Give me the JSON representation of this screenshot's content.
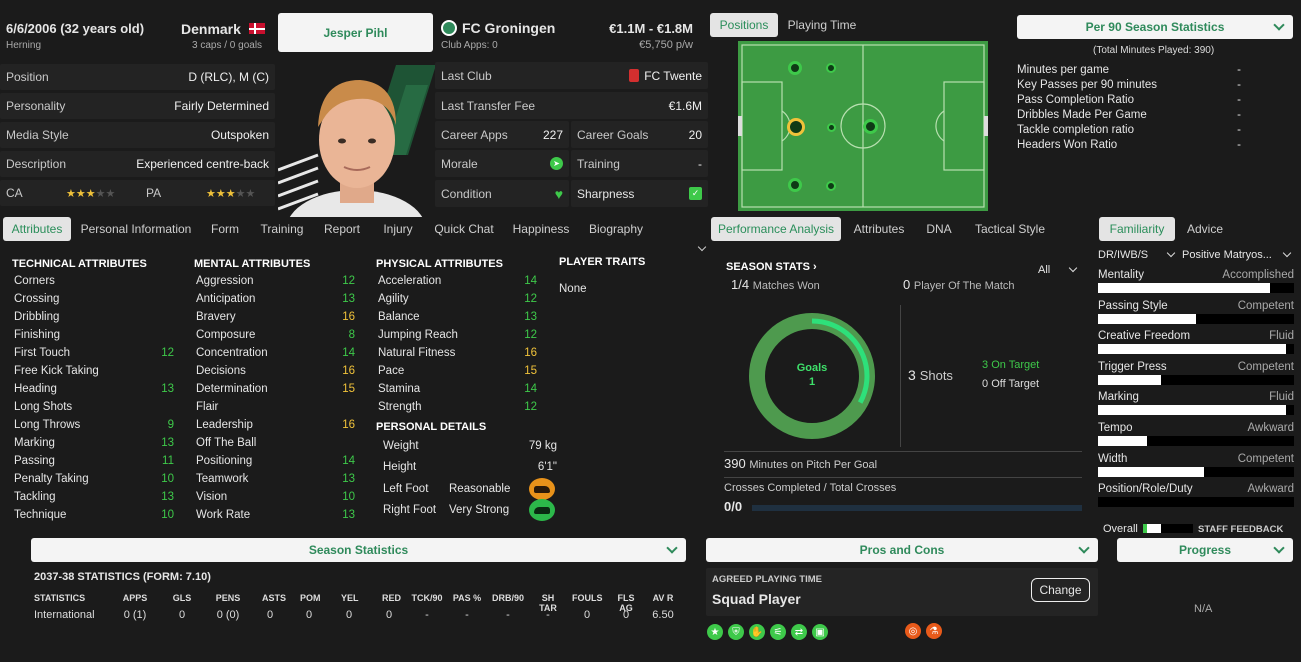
{
  "header": {
    "dob": "6/6/2006 (32 years old)",
    "birthplace": "Herning",
    "nation": "Denmark",
    "caps": "3 caps / 0 goals",
    "name": "Jesper Pihl",
    "club": "FC Groningen",
    "club_apps": "Club Apps: 0",
    "value": "€1.1M - €1.8M",
    "wage": "€5,750 p/w"
  },
  "profile": [
    {
      "label": "Position",
      "value": "D (RLC), M (C)"
    },
    {
      "label": "Personality",
      "value": "Fairly Determined"
    },
    {
      "label": "Media Style",
      "value": "Outspoken"
    },
    {
      "label": "Description",
      "value": "Experienced centre-back"
    }
  ],
  "ability": {
    "ca_label": "CA",
    "pa_label": "PA",
    "ca_stars": 2.5,
    "pa_stars": 2.5
  },
  "career": {
    "last_club_label": "Last Club",
    "last_club": "FC Twente",
    "fee_label": "Last Transfer Fee",
    "fee": "€1.6M",
    "apps_label": "Career Apps",
    "apps": "227",
    "goals_label": "Career Goals",
    "goals": "20",
    "morale_label": "Morale",
    "training_label": "Training",
    "training": "-",
    "condition_label": "Condition",
    "sharpness_label": "Sharpness"
  },
  "main_tabs": [
    "Attributes",
    "Personal Information",
    "Form",
    "Training",
    "Report",
    "Injury",
    "Quick Chat",
    "Happiness",
    "Biography"
  ],
  "technical": {
    "title": "TECHNICAL ATTRIBUTES",
    "items": [
      {
        "n": "Corners",
        "v": ""
      },
      {
        "n": "Crossing",
        "v": ""
      },
      {
        "n": "Dribbling",
        "v": ""
      },
      {
        "n": "Finishing",
        "v": ""
      },
      {
        "n": "First Touch",
        "v": "12"
      },
      {
        "n": "Free Kick Taking",
        "v": ""
      },
      {
        "n": "Heading",
        "v": "13"
      },
      {
        "n": "Long Shots",
        "v": ""
      },
      {
        "n": "Long Throws",
        "v": "9"
      },
      {
        "n": "Marking",
        "v": "13"
      },
      {
        "n": "Passing",
        "v": "11"
      },
      {
        "n": "Penalty Taking",
        "v": "10"
      },
      {
        "n": "Tackling",
        "v": "13"
      },
      {
        "n": "Technique",
        "v": "10"
      }
    ]
  },
  "mental": {
    "title": "MENTAL ATTRIBUTES",
    "items": [
      {
        "n": "Aggression",
        "v": "12"
      },
      {
        "n": "Anticipation",
        "v": "13"
      },
      {
        "n": "Bravery",
        "v": "16"
      },
      {
        "n": "Composure",
        "v": "8"
      },
      {
        "n": "Concentration",
        "v": "14"
      },
      {
        "n": "Decisions",
        "v": "16"
      },
      {
        "n": "Determination",
        "v": "15"
      },
      {
        "n": "Flair",
        "v": ""
      },
      {
        "n": "Leadership",
        "v": "16"
      },
      {
        "n": "Off The Ball",
        "v": ""
      },
      {
        "n": "Positioning",
        "v": "14"
      },
      {
        "n": "Teamwork",
        "v": "13"
      },
      {
        "n": "Vision",
        "v": "10"
      },
      {
        "n": "Work Rate",
        "v": "13"
      }
    ]
  },
  "physical": {
    "title": "PHYSICAL ATTRIBUTES",
    "items": [
      {
        "n": "Acceleration",
        "v": "14"
      },
      {
        "n": "Agility",
        "v": "12"
      },
      {
        "n": "Balance",
        "v": "13"
      },
      {
        "n": "Jumping Reach",
        "v": "12"
      },
      {
        "n": "Natural Fitness",
        "v": "16"
      },
      {
        "n": "Pace",
        "v": "15"
      },
      {
        "n": "Stamina",
        "v": "14"
      },
      {
        "n": "Strength",
        "v": "12"
      }
    ]
  },
  "personal": {
    "title": "PERSONAL DETAILS",
    "weight_label": "Weight",
    "weight": "79 kg",
    "height_label": "Height",
    "height": "6'1\"",
    "left_label": "Left Foot",
    "left": "Reasonable",
    "right_label": "Right Foot",
    "right": "Very Strong"
  },
  "traits": {
    "title": "PLAYER TRAITS",
    "value": "None"
  },
  "pos_tabs": [
    "Positions",
    "Playing Time"
  ],
  "per90": {
    "title": "Per 90 Season Statistics",
    "subtitle": "(Total Minutes Played: 390)",
    "rows": [
      {
        "n": "Minutes per game",
        "v": "-"
      },
      {
        "n": "Key Passes per 90 minutes",
        "v": "-"
      },
      {
        "n": "Pass Completion Ratio",
        "v": "-"
      },
      {
        "n": "Dribbles Made Per Game",
        "v": "-"
      },
      {
        "n": "Tackle completion ratio",
        "v": "-"
      },
      {
        "n": "Headers Won Ratio",
        "v": "-"
      }
    ]
  },
  "perf_tabs": [
    "Performance Analysis",
    "Attributes",
    "DNA",
    "Tactical Style"
  ],
  "season_stats": {
    "title": "SEASON STATS",
    "filter": "All",
    "matches_won": "1/4",
    "matches_won_label": "Matches Won",
    "potm": "0",
    "potm_label": "Player Of The Match",
    "goals_label": "Goals",
    "goals": "1",
    "goals_fraction": 0.33,
    "shots": "3",
    "shots_label": "Shots",
    "on_target": "3",
    "on_target_label": "On Target",
    "off_target": "0",
    "off_target_label": "Off Target",
    "mins_per_goal": "390",
    "mins_per_goal_label": "Minutes on Pitch Per Goal",
    "crosses_label": "Crosses Completed / Total Crosses",
    "crosses": "0/0"
  },
  "fam_tabs": [
    "Familiarity",
    "Advice"
  ],
  "familiarity": {
    "role": "DR/IWB/S",
    "tactic": "Positive Matryos...",
    "items": [
      {
        "n": "Mentality",
        "r": "Accomplished",
        "f": 0.88
      },
      {
        "n": "Passing Style",
        "r": "Competent",
        "f": 0.5
      },
      {
        "n": "Creative Freedom",
        "r": "Fluid",
        "f": 0.96
      },
      {
        "n": "Trigger Press",
        "r": "Competent",
        "f": 0.32
      },
      {
        "n": "Marking",
        "r": "Fluid",
        "f": 0.96
      },
      {
        "n": "Tempo",
        "r": "Awkward",
        "f": 0.25
      },
      {
        "n": "Width",
        "r": "Competent",
        "f": 0.54
      },
      {
        "n": "Position/Role/Duty",
        "r": "Awkward",
        "f": 0.0
      }
    ],
    "overall_label": "Overall",
    "feedback": "STAFF FEEDBACK"
  },
  "season_statistics": {
    "title": "Season Statistics",
    "heading": "2037-38 STATISTICS (FORM: 7.10)",
    "columns": [
      "STATISTICS",
      "APPS",
      "GLS",
      "PENS",
      "ASTS",
      "POM",
      "YEL",
      "RED",
      "TCK/90",
      "PAS %",
      "DRB/90",
      "SH TAR",
      "FOULS",
      "FLS AG",
      "AV R"
    ],
    "row": [
      "International",
      "0 (1)",
      "0",
      "0 (0)",
      "0",
      "0",
      "0",
      "0",
      "-",
      "-",
      "-",
      "-",
      "0",
      "0",
      "6.50"
    ]
  },
  "pros_cons": {
    "title": "Pros and Cons"
  },
  "playing_time": {
    "label": "AGREED PLAYING TIME",
    "value": "Squad Player",
    "button": "Change"
  },
  "progress": {
    "title": "Progress",
    "value": "N/A"
  },
  "colors": {
    "accent": "#2f8a5b",
    "green": "#3ec94a",
    "yellow": "#f0c23a",
    "pitch": "#3d9b43"
  }
}
